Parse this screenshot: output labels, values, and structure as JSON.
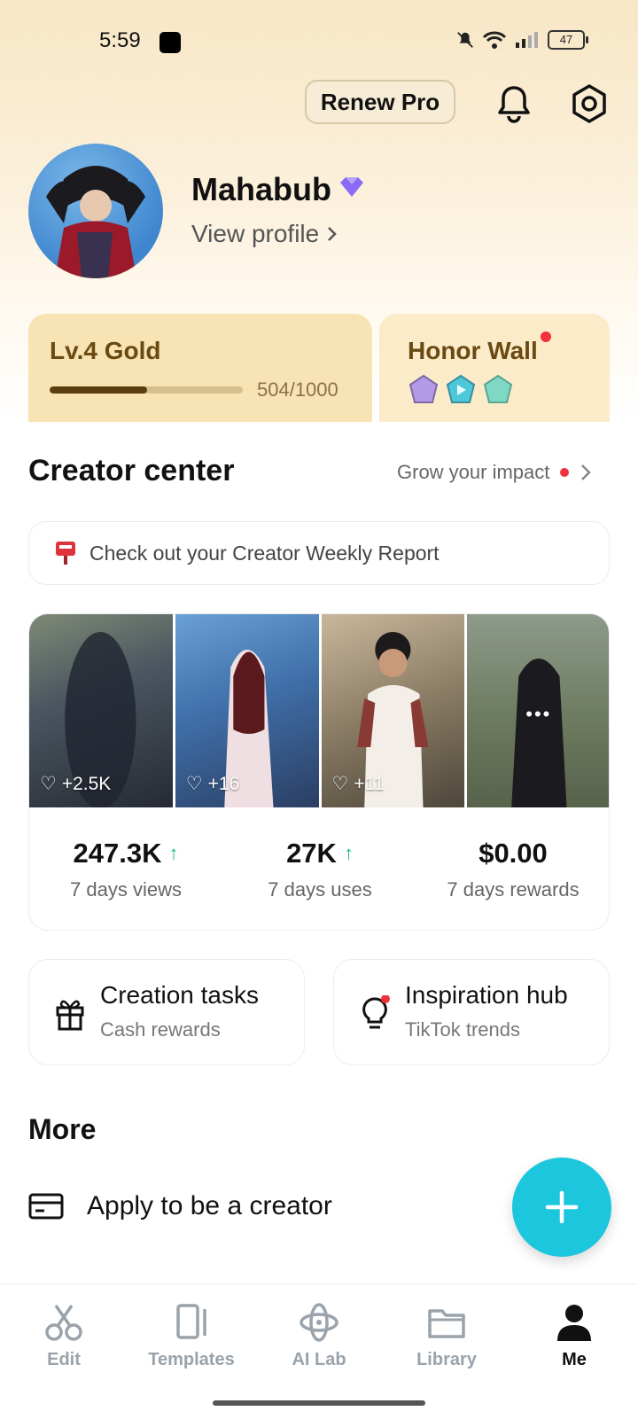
{
  "status_bar": {
    "time": "5:59",
    "battery": "47"
  },
  "header": {
    "renew_label": "Renew Pro"
  },
  "profile": {
    "name": "Mahabub",
    "view_profile": "View profile"
  },
  "level": {
    "title": "Lv.4 Gold",
    "score": "504/1000",
    "progress": 0.504
  },
  "honor": {
    "title": "Honor Wall"
  },
  "creator_center": {
    "title": "Creator center",
    "grow_label": "Grow your impact",
    "report_label": "Check out your Creator Weekly Report",
    "thumbnails": [
      {
        "likes": "+2.5K"
      },
      {
        "likes": "+16"
      },
      {
        "likes": "+11"
      },
      {
        "likes": ""
      }
    ],
    "stats": [
      {
        "value": "247.3K",
        "label": "7 days views",
        "trend": "up"
      },
      {
        "value": "27K",
        "label": "7 days uses",
        "trend": "up"
      },
      {
        "value": "$0.00",
        "label": "7 days rewards"
      }
    ]
  },
  "tasks": [
    {
      "title": "Creation tasks",
      "subtitle": "Cash rewards",
      "icon": "gift-icon"
    },
    {
      "title": "Inspiration hub",
      "subtitle": "TikTok trends",
      "icon": "lightbulb-icon"
    }
  ],
  "more": {
    "title": "More",
    "apply_label": "Apply to be a creator"
  },
  "nav": [
    {
      "label": "Edit",
      "icon": "scissors-icon"
    },
    {
      "label": "Templates",
      "icon": "templates-icon"
    },
    {
      "label": "AI Lab",
      "icon": "ai-lab-icon"
    },
    {
      "label": "Library",
      "icon": "folder-icon"
    },
    {
      "label": "Me",
      "icon": "person-icon",
      "active": true
    }
  ],
  "colors": {
    "accent": "#1cc6dd",
    "gold_text": "#6a4a12",
    "up_arrow": "#1fbd7a",
    "notification_dot": "#f0313e"
  }
}
